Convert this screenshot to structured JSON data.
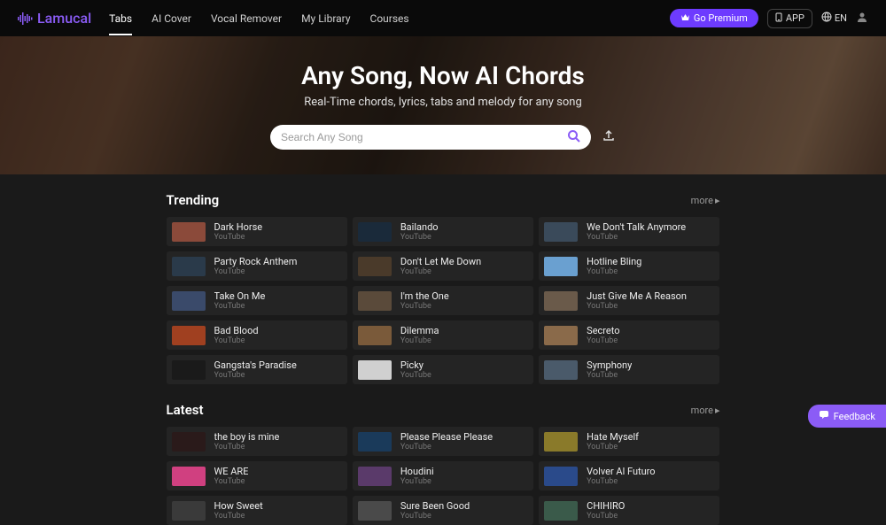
{
  "brand": "Lamucal",
  "nav": {
    "tabs": "Tabs",
    "aicover": "AI Cover",
    "vocal": "Vocal Remover",
    "library": "My Library",
    "courses": "Courses"
  },
  "header": {
    "premium": "Go Premium",
    "app": "APP",
    "lang": "EN"
  },
  "hero": {
    "title": "Any Song, Now AI Chords",
    "subtitle": "Real-Time chords, lyrics, tabs and melody for any song"
  },
  "search": {
    "placeholder": "Search Any Song"
  },
  "trending": {
    "title": "Trending",
    "more": "more",
    "items": [
      {
        "title": "Dark Horse",
        "source": "YouTube",
        "thumb": "#8b4a3a"
      },
      {
        "title": "Bailando",
        "source": "YouTube",
        "thumb": "#1a2a3a"
      },
      {
        "title": "We Don't Talk Anymore",
        "source": "YouTube",
        "thumb": "#3a4a5a"
      },
      {
        "title": "Party Rock Anthem",
        "source": "YouTube",
        "thumb": "#2a3a4a"
      },
      {
        "title": "Don't Let Me Down",
        "source": "YouTube",
        "thumb": "#4a3a2a"
      },
      {
        "title": "Hotline Bling",
        "source": "YouTube",
        "thumb": "#6aa0d0"
      },
      {
        "title": "Take On Me",
        "source": "YouTube",
        "thumb": "#3a4a6a"
      },
      {
        "title": "I'm the One",
        "source": "YouTube",
        "thumb": "#5a4a3a"
      },
      {
        "title": "Just Give Me A Reason",
        "source": "YouTube",
        "thumb": "#6a5a4a"
      },
      {
        "title": "Bad Blood",
        "source": "YouTube",
        "thumb": "#a04020"
      },
      {
        "title": "Dilemma",
        "source": "YouTube",
        "thumb": "#7a5a3a"
      },
      {
        "title": "Secreto",
        "source": "YouTube",
        "thumb": "#8a6a4a"
      },
      {
        "title": "Gangsta's Paradise",
        "source": "YouTube",
        "thumb": "#1a1a1a"
      },
      {
        "title": "Picky",
        "source": "YouTube",
        "thumb": "#d0d0d0"
      },
      {
        "title": "Symphony",
        "source": "YouTube",
        "thumb": "#4a5a6a"
      }
    ]
  },
  "latest": {
    "title": "Latest",
    "more": "more",
    "items": [
      {
        "title": "the boy is mine",
        "source": "YouTube",
        "thumb": "#2a1a1a"
      },
      {
        "title": "Please Please Please",
        "source": "YouTube",
        "thumb": "#1a3a5a"
      },
      {
        "title": "Hate Myself",
        "source": "YouTube",
        "thumb": "#8a7a2a"
      },
      {
        "title": "WE ARE",
        "source": "YouTube",
        "thumb": "#d04080"
      },
      {
        "title": "Houdini",
        "source": "YouTube",
        "thumb": "#5a3a6a"
      },
      {
        "title": "Volver Al Futuro",
        "source": "YouTube",
        "thumb": "#2a4a8a"
      },
      {
        "title": "How Sweet",
        "source": "YouTube",
        "thumb": "#3a3a3a"
      },
      {
        "title": "Sure Been Good",
        "source": "YouTube",
        "thumb": "#4a4a4a"
      },
      {
        "title": "CHIHIRO",
        "source": "YouTube",
        "thumb": "#3a5a4a"
      }
    ]
  },
  "feedback": "Feedback"
}
